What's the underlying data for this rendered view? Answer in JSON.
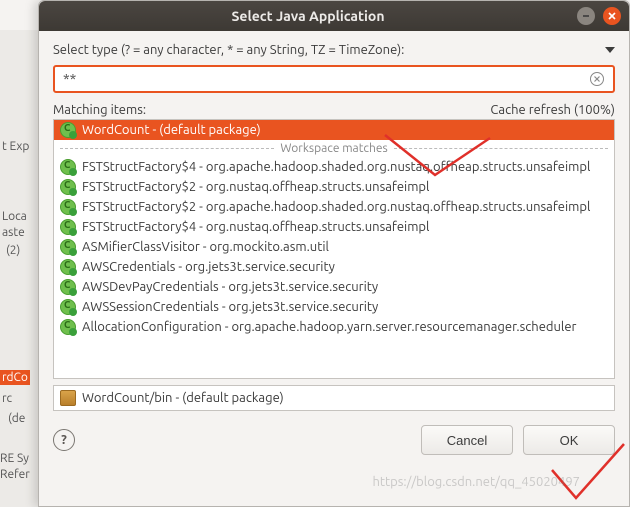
{
  "window": {
    "title": "Select Java Application"
  },
  "prompt": "Select type (? = any character, * = any String, TZ = TimeZone):",
  "search": {
    "value": "**",
    "placeholder": ""
  },
  "labels": {
    "matching": "Matching items:",
    "cache": "Cache refresh (100%)",
    "workspace_sep": "Workspace matches"
  },
  "items": [
    {
      "label": "WordCount - (default package)",
      "selected": true
    },
    {
      "label": "FSTStructFactory$4 - org.apache.hadoop.shaded.org.nustaq.offheap.structs.unsafeimpl"
    },
    {
      "label": "FSTStructFactory$2 - org.nustaq.offheap.structs.unsafeimpl"
    },
    {
      "label": "FSTStructFactory$2 - org.apache.hadoop.shaded.org.nustaq.offheap.structs.unsafeimpl"
    },
    {
      "label": "FSTStructFactory$4 - org.nustaq.offheap.structs.unsafeimpl"
    },
    {
      "label": "ASMifierClassVisitor - org.mockito.asm.util"
    },
    {
      "label": "AWSCredentials - org.jets3t.service.security"
    },
    {
      "label": "AWSDevPayCredentials - org.jets3t.service.security"
    },
    {
      "label": "AWSSessionCredentials - org.jets3t.service.security"
    },
    {
      "label": "AllocationConfiguration - org.apache.hadoop.yarn.server.resourcemanager.scheduler"
    }
  ],
  "detail": "WordCount/bin - (default package)",
  "buttons": {
    "cancel": "Cancel",
    "ok": "OK"
  },
  "bg": {
    "t1": "t Exp",
    "t2": "Loca",
    "t3": "aste",
    "t4": "(2)",
    "t5": "rdCo",
    "t6": "rc",
    "t7": "(de",
    "t8": "RE Sy",
    "t9": "Refer"
  },
  "watermark": "https://blog.csdn.net/qq_45020497"
}
